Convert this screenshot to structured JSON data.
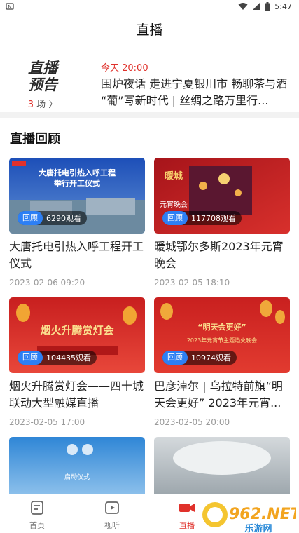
{
  "status_bar": {
    "time": "5:47"
  },
  "header": {
    "title": "直播"
  },
  "preview": {
    "logo_line1": "直播",
    "logo_line2": "预告",
    "count_num": "3",
    "count_unit": "场 〉",
    "time": "今天 20:00",
    "text": "围炉夜话 走进宁夏银川市 畅聊茶与酒 “葡”写新时代 | 丝绸之路万里行..."
  },
  "section": {
    "title": "直播回顾"
  },
  "cards": [
    {
      "tag": "回顾",
      "views": "6290观看",
      "title": "大唐托电引热入呼工程开工仪式",
      "date": "2023-02-06 09:20",
      "thumb_text1": "大唐托电引热入呼工程",
      "thumb_text2": "举行开工仪式"
    },
    {
      "tag": "回顾",
      "views": "117708观看",
      "title": "暖城鄂尔多斯2023年元宵晚会",
      "date": "2023-02-05 18:10",
      "thumb_text1": "暖城",
      "thumb_text2": "元宵晚会"
    },
    {
      "tag": "回顾",
      "views": "104435观看",
      "title": "烟火升腾赏灯会——四十城联动大型融媒直播",
      "date": "2023-02-05 17:00",
      "thumb_text1": "烟火升腾赏灯会",
      "thumb_text2": ""
    },
    {
      "tag": "回顾",
      "views": "10974观看",
      "title": "巴彦淖尔 | 乌拉特前旗“明天会更好” 2023年元宵...",
      "date": "2023-02-05 20:00",
      "thumb_text1": "“明天会更好”",
      "thumb_text2": "2023年元宵节主题焰火晚会"
    },
    {
      "tag": "",
      "views": "",
      "title": "",
      "date": "",
      "thumb_text1": "启动仪式",
      "thumb_text2": ""
    },
    {
      "tag": "",
      "views": "",
      "title": "",
      "date": "",
      "thumb_text1": "",
      "thumb_text2": ""
    }
  ],
  "tabs": [
    {
      "label": "首页",
      "icon": "home-icon"
    },
    {
      "label": "视听",
      "icon": "video-icon"
    },
    {
      "label": "直播",
      "icon": "live-camera-icon"
    }
  ],
  "watermark": {
    "text": "962.NET",
    "sub": "乐游网"
  },
  "colors": {
    "accent": "#e0312b",
    "badge_blue": "#2d7ff4"
  }
}
